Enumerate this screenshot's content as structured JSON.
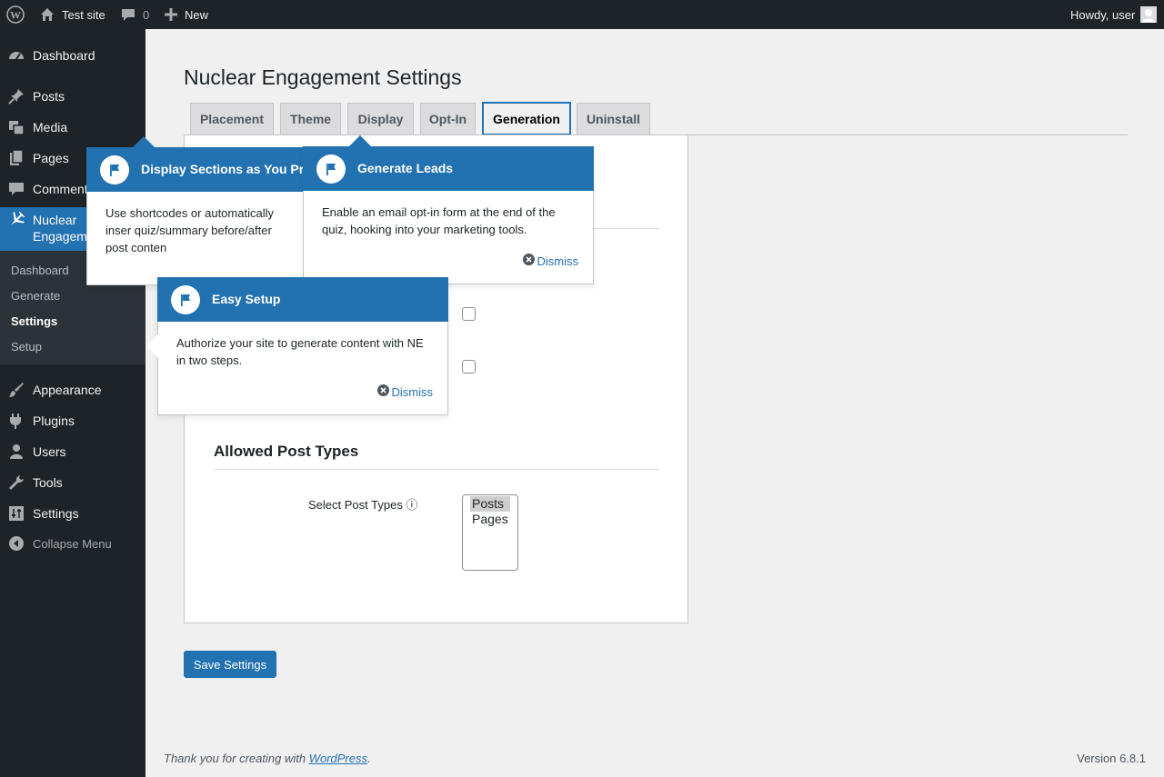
{
  "adminbar": {
    "site_name": "Test site",
    "comments_count": "0",
    "new_label": "New",
    "greeting": "Howdy, user"
  },
  "sidebar": {
    "items": [
      {
        "label": "Dashboard",
        "icon": "dashboard-icon"
      },
      {
        "label": "Posts",
        "icon": "pin-icon"
      },
      {
        "label": "Media",
        "icon": "media-icon"
      },
      {
        "label": "Pages",
        "icon": "pages-icon"
      },
      {
        "label": "Comments",
        "icon": "comment-icon"
      },
      {
        "label": "Nuclear Engagement",
        "icon": "airplane-icon"
      },
      {
        "label": "Appearance",
        "icon": "brush-icon"
      },
      {
        "label": "Plugins",
        "icon": "plugin-icon"
      },
      {
        "label": "Users",
        "icon": "user-icon"
      },
      {
        "label": "Tools",
        "icon": "wrench-icon"
      },
      {
        "label": "Settings",
        "icon": "settings-icon"
      },
      {
        "label": "Collapse Menu",
        "icon": "collapse-icon"
      }
    ],
    "ne_line1": "Nuclear",
    "ne_line2": "Engagem",
    "submenu": [
      "Dashboard",
      "Generate",
      "Settings",
      "Setup"
    ],
    "current_sub": "Settings"
  },
  "main": {
    "title": "Nuclear Engagement Settings",
    "tabs": [
      "Placement",
      "Theme",
      "Display",
      "Opt-In",
      "Generation",
      "Uninstall"
    ],
    "active_tab": "Generation",
    "allowed_post_types_heading": "Allowed Post Types",
    "select_label": "Select Post Types ⓘ",
    "post_type_options": [
      "Posts",
      "Pages"
    ],
    "selected_post_type": "Posts",
    "save_button": "Save Settings"
  },
  "pointers": [
    {
      "title": "Display Sections as You Pr",
      "body": "Use shortcodes or automatically inser quiz/summary before/after post conten"
    },
    {
      "title": "Generate Leads",
      "body": "Enable an email opt-in form at the end of the quiz, hooking into your marketing tools.",
      "dismiss": "Dismiss"
    },
    {
      "title": "Easy Setup",
      "body": "Authorize your site to generate content with NE in two steps.",
      "dismiss": "Dismiss"
    }
  ],
  "footer": {
    "thanks_prefix": "Thank you for creating with ",
    "thanks_link": "WordPress",
    "thanks_suffix": ".",
    "version": "Version 6.8.1"
  },
  "colors": {
    "admin_dark": "#1d2327",
    "accent_blue": "#2271b1",
    "submenu_bg": "#2c3338"
  }
}
